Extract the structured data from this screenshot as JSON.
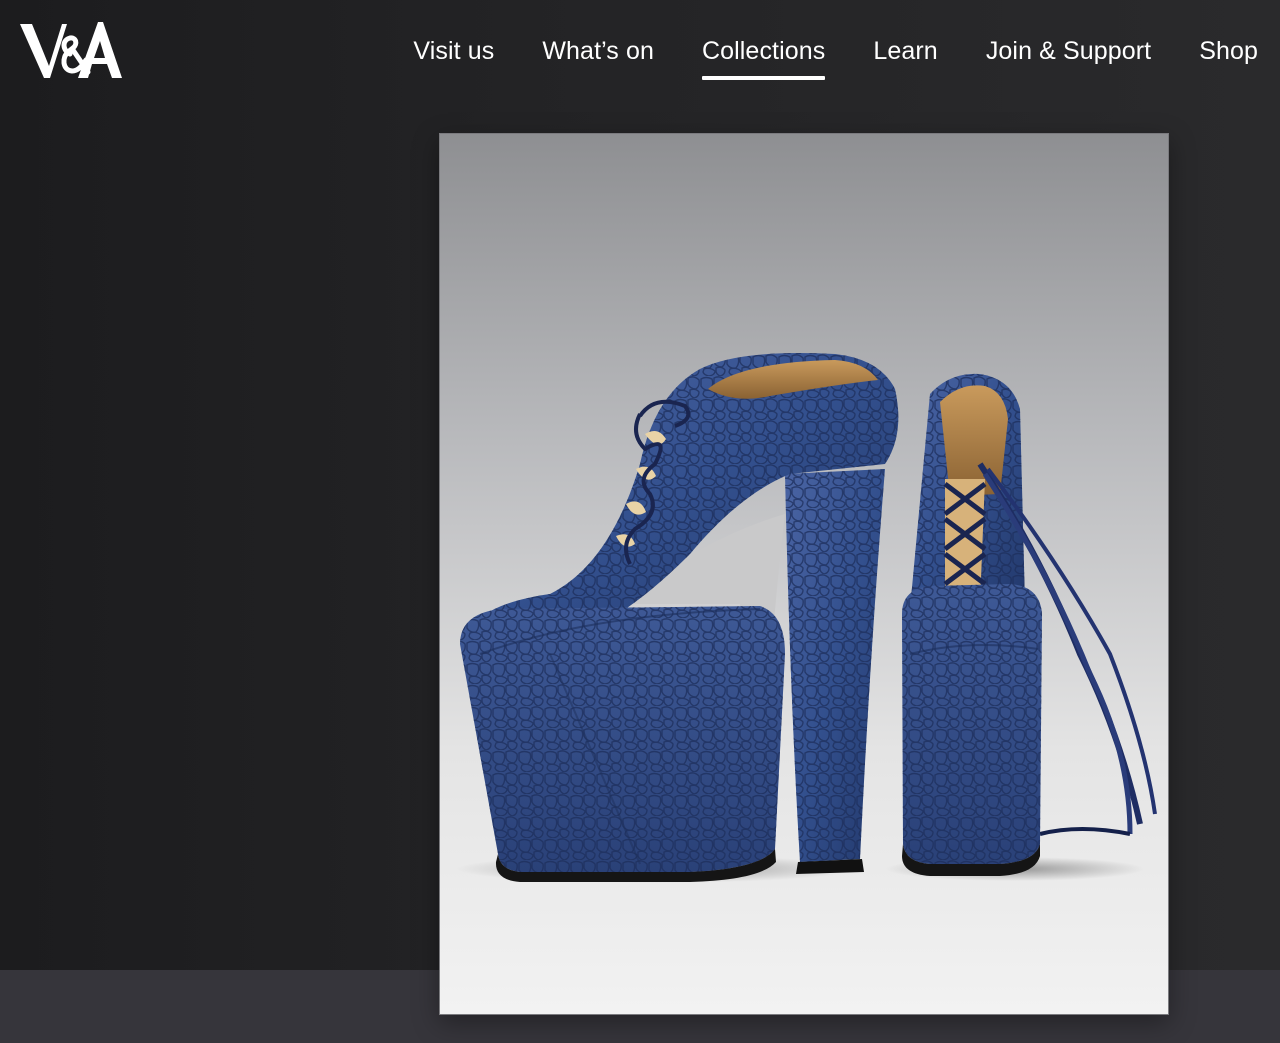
{
  "header": {
    "logo_text": "V&A",
    "nav": [
      {
        "label": "Visit us",
        "active": false
      },
      {
        "label": "What’s on",
        "active": false
      },
      {
        "label": "Collections",
        "active": true
      },
      {
        "label": "Learn",
        "active": false
      },
      {
        "label": "Join & Support",
        "active": false
      },
      {
        "label": "Shop",
        "active": false
      }
    ]
  },
  "hero": {
    "image_subject": "blue-croc-platform-shoes"
  },
  "colors": {
    "page_background": "#232325",
    "lower_band": "#36353b",
    "shoe_blue": "#34508c",
    "nav_text": "#ffffff"
  }
}
